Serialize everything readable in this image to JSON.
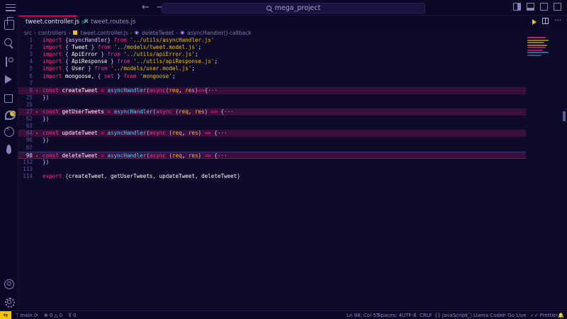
{
  "titlebar": {
    "search_text": "mega_project"
  },
  "tabs": [
    {
      "label": "tweet.controller.js",
      "active": true
    },
    {
      "label": "tweet.routes.js",
      "active": false
    }
  ],
  "breadcrumb": [
    "src",
    "controllers",
    "tweet.controller.js",
    "deleteTweet",
    "asyncHandler() callback"
  ],
  "editor": {
    "lines": [
      {
        "n": "1",
        "tokens": [
          [
            "kw",
            "import "
          ],
          [
            "brace",
            "{asyncHandler} "
          ],
          [
            "kw",
            "from "
          ],
          [
            "str",
            "'../utils/asyncHandler.js'"
          ]
        ]
      },
      {
        "n": "2",
        "tokens": [
          [
            "kw",
            "import "
          ],
          [
            "brace",
            "{ "
          ],
          [
            "plain",
            "Tweet "
          ],
          [
            "brace",
            "} "
          ],
          [
            "kw",
            "from "
          ],
          [
            "str",
            "'../models/tweet.model.js'"
          ],
          [
            "plain",
            ";"
          ]
        ]
      },
      {
        "n": "3",
        "tokens": [
          [
            "kw",
            "import "
          ],
          [
            "brace",
            "{ "
          ],
          [
            "plain",
            "ApiError "
          ],
          [
            "brace",
            "} "
          ],
          [
            "kw",
            "from "
          ],
          [
            "str",
            "'../utils/apiError.js'"
          ],
          [
            "plain",
            ";"
          ]
        ]
      },
      {
        "n": "4",
        "tokens": [
          [
            "kw",
            "import "
          ],
          [
            "brace",
            "{ "
          ],
          [
            "plain",
            "ApiResponse "
          ],
          [
            "brace",
            "} "
          ],
          [
            "kw",
            "from "
          ],
          [
            "str",
            "'../utils/apiResponse.js'"
          ],
          [
            "plain",
            ";"
          ]
        ]
      },
      {
        "n": "5",
        "tokens": [
          [
            "kw",
            "import "
          ],
          [
            "brace",
            "{ "
          ],
          [
            "plain",
            "User "
          ],
          [
            "brace",
            "} "
          ],
          [
            "kw",
            "from "
          ],
          [
            "str",
            "'../models/user.model.js'"
          ],
          [
            "plain",
            ";"
          ]
        ]
      },
      {
        "n": "6",
        "tokens": [
          [
            "kw",
            "import "
          ],
          [
            "plain",
            "mongoose, "
          ],
          [
            "brace",
            "{ "
          ],
          [
            "kw",
            "set "
          ],
          [
            "brace",
            "} "
          ],
          [
            "kw",
            "from "
          ],
          [
            "str",
            "'mongoose'"
          ],
          [
            "plain",
            ";"
          ]
        ]
      },
      {
        "n": "7",
        "tokens": []
      },
      {
        "n": "8",
        "fold": true,
        "hl": true,
        "tokens": [
          [
            "kw",
            "const "
          ],
          [
            "plain",
            "createTweet "
          ],
          [
            "kw",
            "= "
          ],
          [
            "fn",
            "asyncHandler"
          ],
          [
            "brace",
            "("
          ],
          [
            "kw",
            "async"
          ],
          [
            "brace",
            "("
          ],
          [
            "str",
            "req"
          ],
          [
            "plain",
            ", "
          ],
          [
            "str",
            "res"
          ],
          [
            "brace",
            ")"
          ],
          [
            "kw",
            "=>"
          ],
          [
            "brace",
            "{"
          ],
          [
            "ellipsis",
            "···"
          ]
        ]
      },
      {
        "n": "25",
        "tokens": [
          [
            "brace",
            "})"
          ]
        ]
      },
      {
        "n": "26",
        "tokens": []
      },
      {
        "n": "27",
        "fold": true,
        "hl": true,
        "tokens": [
          [
            "kw",
            "const "
          ],
          [
            "plain",
            "getUserTweets "
          ],
          [
            "kw",
            "= "
          ],
          [
            "fn",
            "asyncHandler"
          ],
          [
            "brace",
            "("
          ],
          [
            "kw",
            "async "
          ],
          [
            "brace",
            "("
          ],
          [
            "str",
            "req"
          ],
          [
            "plain",
            ", "
          ],
          [
            "str",
            "res"
          ],
          [
            "brace",
            ") "
          ],
          [
            "kw",
            "=> "
          ],
          [
            "brace",
            "{"
          ],
          [
            "ellipsis",
            "···"
          ]
        ]
      },
      {
        "n": "62",
        "tokens": [
          [
            "brace",
            "})"
          ]
        ]
      },
      {
        "n": "63",
        "tokens": []
      },
      {
        "n": "64",
        "fold": true,
        "hl": true,
        "tokens": [
          [
            "kw",
            "const "
          ],
          [
            "plain",
            "updateTweet "
          ],
          [
            "kw",
            "= "
          ],
          [
            "fn",
            "asyncHandler"
          ],
          [
            "brace",
            "("
          ],
          [
            "kw",
            "async "
          ],
          [
            "brace",
            "("
          ],
          [
            "str",
            "req"
          ],
          [
            "plain",
            ", "
          ],
          [
            "str",
            "res"
          ],
          [
            "brace",
            ") "
          ],
          [
            "kw",
            "=> "
          ],
          [
            "brace",
            "{"
          ],
          [
            "ellipsis",
            "···"
          ]
        ]
      },
      {
        "n": "96",
        "tokens": [
          [
            "brace",
            "})"
          ]
        ]
      },
      {
        "n": "97",
        "tokens": []
      },
      {
        "n": "98",
        "fold": true,
        "hl": true,
        "cur": true,
        "tokens": [
          [
            "kw",
            "const "
          ],
          [
            "plain",
            "deleteTweet "
          ],
          [
            "kw",
            "= "
          ],
          [
            "fn",
            "asyncHandler"
          ],
          [
            "brace",
            "("
          ],
          [
            "kw",
            "async "
          ],
          [
            "brace",
            "("
          ],
          [
            "str",
            "req"
          ],
          [
            "plain",
            ", "
          ],
          [
            "str",
            "res"
          ],
          [
            "brace",
            ") "
          ],
          [
            "kw",
            "=> "
          ],
          [
            "brace",
            "{"
          ],
          [
            "ellipsis",
            "···"
          ]
        ]
      },
      {
        "n": "112",
        "tokens": [
          [
            "brace",
            "})"
          ]
        ]
      },
      {
        "n": "113",
        "tokens": []
      },
      {
        "n": "114",
        "tokens": [
          [
            "kw",
            "export "
          ],
          [
            "brace",
            "{"
          ],
          [
            "plain",
            "createTweet, getUserTweets, updateTweet, deleteTweet"
          ],
          [
            "brace",
            "}"
          ]
        ]
      }
    ]
  },
  "statusbar": {
    "branch": "main",
    "errors": "0",
    "warnings": "0",
    "ports": "0",
    "position": "Ln 98, Col 55",
    "spaces": "Spaces: 4",
    "encoding": "UTF-8",
    "eol": "CRLF",
    "language": "JavaScript",
    "llama": "Llama Coder",
    "golive": "Go Live",
    "prettier": "Prettier"
  },
  "colors": {
    "keyword": "#ff2e88",
    "string": "#f0c400",
    "function": "#36d9ff",
    "background": "#0d0a2a"
  }
}
